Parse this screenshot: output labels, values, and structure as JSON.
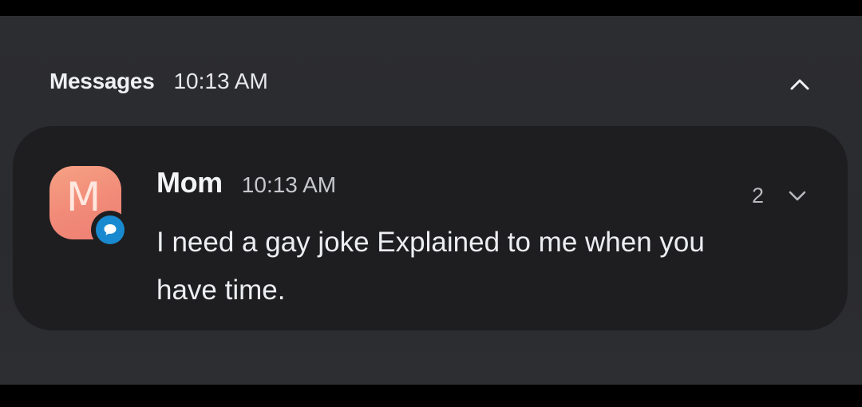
{
  "group": {
    "app_name": "Messages",
    "time": "10:13 AM",
    "collapse_icon": "chevron-up-icon"
  },
  "notification": {
    "avatar": {
      "letter": "M",
      "gradient_from": "#f6a184",
      "gradient_to": "#ee7f73",
      "badge_icon": "chat-bubble-icon",
      "badge_color": "#1a8ad0"
    },
    "sender": "Mom",
    "time": "10:13 AM",
    "count": "2",
    "expand_icon": "chevron-down-icon",
    "message": "I need a gay joke Explained to me when you have time."
  },
  "colors": {
    "background": "#2b2c30",
    "card": "#1e1e20",
    "text_primary": "#f3f4f6",
    "text_secondary": "#c7c8cc"
  }
}
